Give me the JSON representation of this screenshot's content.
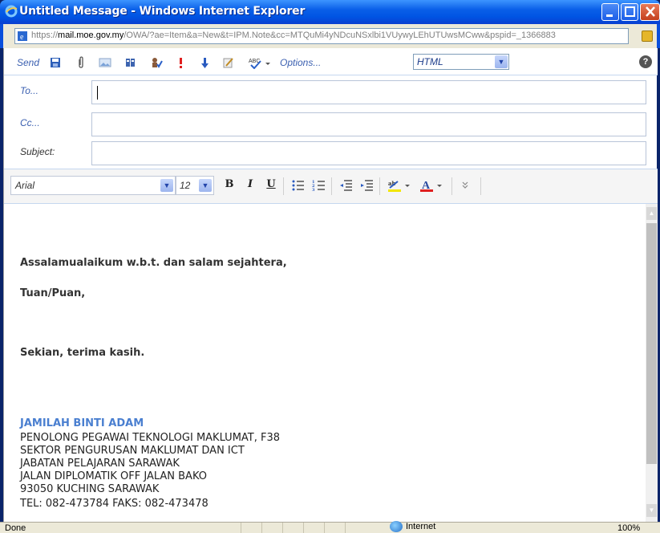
{
  "window": {
    "title": "Untitled Message - Windows Internet Explorer"
  },
  "address": {
    "protocol": "https://",
    "domain": "mail.moe.gov.my",
    "path": "/OWA/?ae=Item&a=New&t=IPM.Note&cc=MTQuMi4yNDcuNSxlbi1VUywyLEhUTUwsMCww&pspid=_1366883"
  },
  "toolbar": {
    "send_label": "Send",
    "options_label": "Options...",
    "format_value": "HTML",
    "help_label": "?"
  },
  "fields": {
    "to_label": "To...",
    "cc_label": "Cc...",
    "subject_label": "Subject:"
  },
  "format_bar": {
    "font_value": "Arial",
    "size_value": "12",
    "bold_label": "B",
    "italic_label": "I",
    "underline_label": "U"
  },
  "message": {
    "greeting": "Assalamualaikum w.b.t. dan salam sejahtera,",
    "salutation": "Tuan/Puan,",
    "closing": "Sekian, terima kasih.",
    "signature_name": "JAMILAH BINTI ADAM",
    "signature_lines": [
      "PENOLONG PEGAWAI TEKNOLOGI MAKLUMAT, F38",
      "SEKTOR PENGURUSAN MAKLUMAT DAN ICT",
      "JABATAN PELAJARAN SARAWAK",
      "JALAN DIPLOMATIK OFF JALAN BAKO",
      "93050 KUCHING SARAWAK",
      "TEL: 082-473784 FAKS: 082-473478"
    ]
  },
  "statusbar": {
    "status": "Done",
    "zone": "Internet",
    "zoom": "100%"
  }
}
